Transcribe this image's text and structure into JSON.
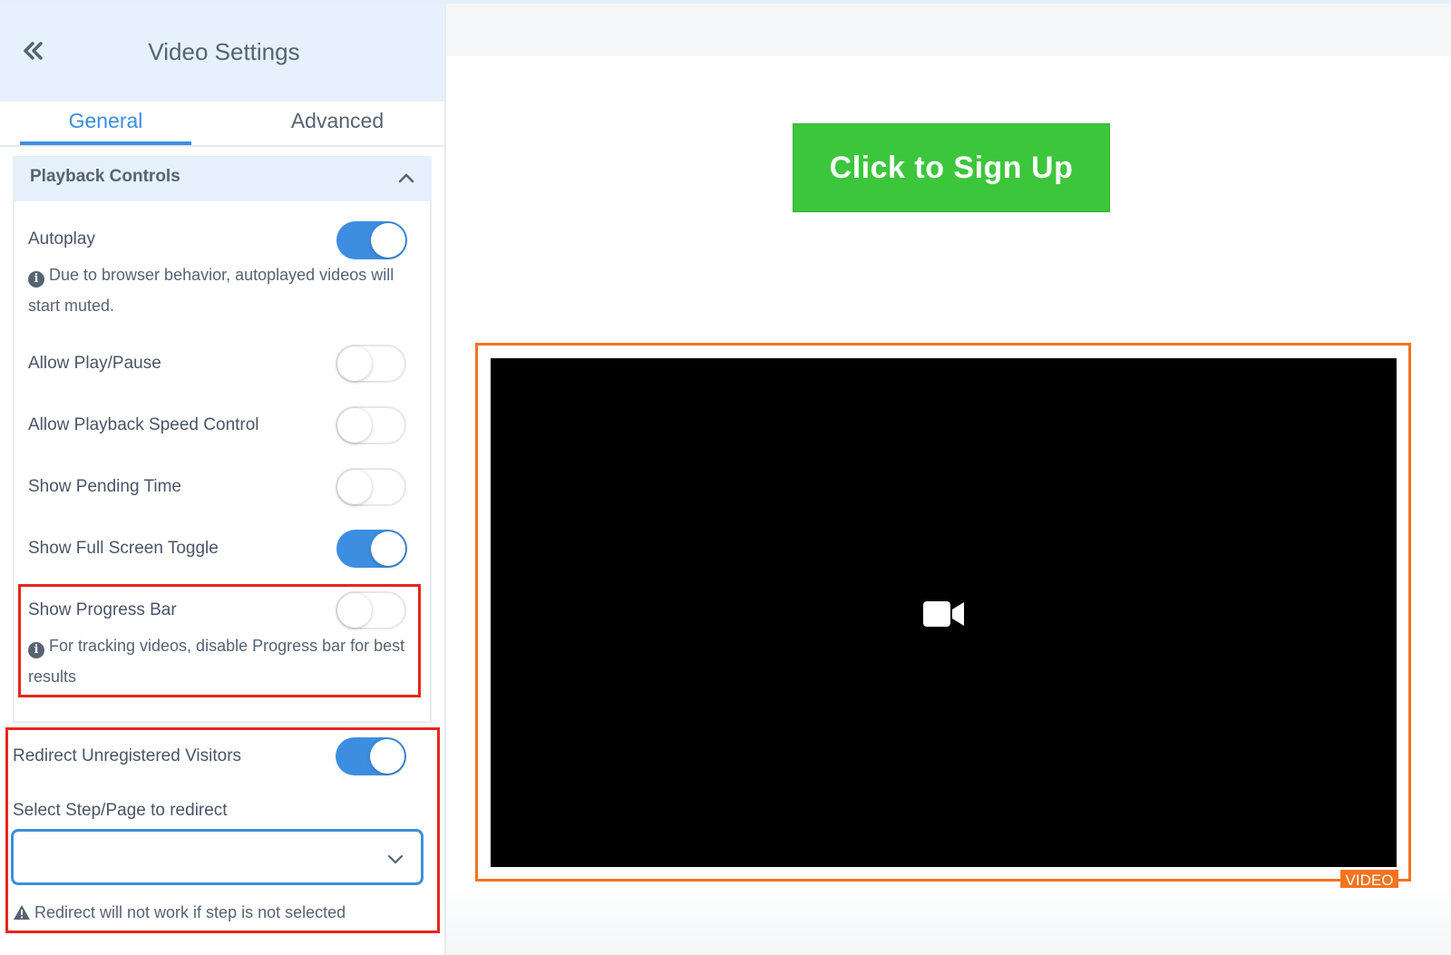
{
  "sidebar": {
    "title": "Video Settings",
    "tabs": [
      {
        "label": "General",
        "active": true
      },
      {
        "label": "Advanced",
        "active": false
      }
    ],
    "section": {
      "title": "Playback Controls",
      "expanded": true
    },
    "settings": [
      {
        "label": "Autoplay",
        "enabled": true,
        "note": "Due to browser behavior, autoplayed videos will start muted."
      },
      {
        "label": "Allow Play/Pause",
        "enabled": false
      },
      {
        "label": "Allow Playback Speed Control",
        "enabled": false
      },
      {
        "label": "Show Pending Time",
        "enabled": false
      },
      {
        "label": "Show Full Screen Toggle",
        "enabled": true
      },
      {
        "label": "Show Progress Bar",
        "enabled": false,
        "note": "For tracking videos, disable Progress bar for best results"
      }
    ],
    "redirect": {
      "label": "Redirect Unregistered Visitors",
      "enabled": true,
      "select_label": "Select Step/Page to redirect",
      "select_value": "",
      "warning": "Redirect will not work if step is not selected"
    }
  },
  "canvas": {
    "cta_label": "Click to Sign Up",
    "video_tag": "VIDEO"
  },
  "colors": {
    "accent": "#3d8ee0",
    "cta": "#3cc63c",
    "highlight": "#e5271c",
    "video_border": "#f47321"
  },
  "icons": [
    "double-chevron-left-icon",
    "chevron-up-icon",
    "info-icon",
    "chevron-down-icon",
    "warning-icon",
    "video-camera-icon"
  ]
}
